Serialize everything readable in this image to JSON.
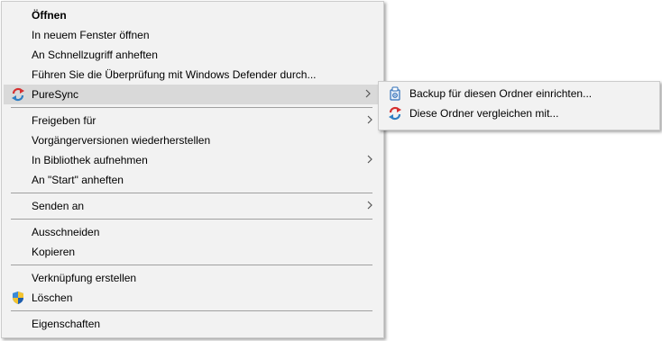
{
  "context_menu": {
    "items": [
      {
        "label": "Öffnen"
      },
      {
        "label": "In neuem Fenster öffnen"
      },
      {
        "label": "An Schnellzugriff anheften"
      },
      {
        "label": "Führen Sie die Überprüfung mit Windows Defender durch..."
      },
      {
        "label": "PureSync"
      },
      {
        "label": "Freigeben für"
      },
      {
        "label": "Vorgängerversionen wiederherstellen"
      },
      {
        "label": "In Bibliothek aufnehmen"
      },
      {
        "label": "An \"Start\" anheften"
      },
      {
        "label": "Senden an"
      },
      {
        "label": "Ausschneiden"
      },
      {
        "label": "Kopieren"
      },
      {
        "label": "Verknüpfung erstellen"
      },
      {
        "label": "Löschen"
      },
      {
        "label": "Eigenschaften"
      }
    ]
  },
  "submenu": {
    "items": [
      {
        "label": "Backup für diesen Ordner einrichten..."
      },
      {
        "label": "Diese Ordner vergleichen mit..."
      }
    ]
  },
  "icons": {
    "puresync": "puresync-sync-icon",
    "backup": "backup-device-icon",
    "uac_shield": "uac-shield-icon",
    "submenu_arrow": "chevron-right-icon"
  },
  "colors": {
    "menu_background": "#f2f2f2",
    "highlight": "#d9d9d9",
    "separator": "#a0a0a0",
    "sync_red": "#d62f2f",
    "sync_blue": "#2f7fc4"
  }
}
